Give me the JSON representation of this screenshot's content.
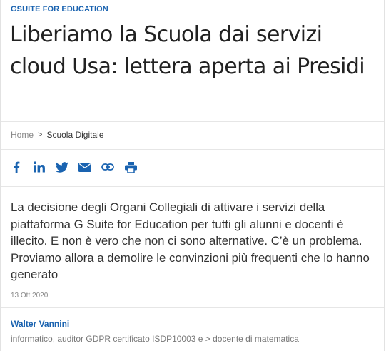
{
  "article": {
    "category": "GSUITE FOR EDUCATION",
    "title": "Liberiamo la Scuola dai servizi cloud Usa: lettera aperta ai Presidi",
    "lead": "La decisione degli Organi Collegiali di attivare i servizi della piattaforma G Suite for Education per tutti gli alunni e docenti è illecito. E non è vero che non ci sono alternative. C’è un problema. Proviamo allora a demolire le convinzioni più frequenti che lo hanno generato",
    "date": "13 Ott 2020"
  },
  "breadcrumb": {
    "home": "Home",
    "separator": ">",
    "current": "Scuola Digitale"
  },
  "share": {
    "icons": [
      "facebook-icon",
      "linkedin-icon",
      "twitter-icon",
      "email-icon",
      "link-icon",
      "print-icon"
    ],
    "color": "#1a63b0"
  },
  "author": {
    "name": "Walter Vannini",
    "bio": "informatico, auditor GDPR certificato ISDP10003 e > docente di matematica"
  },
  "colors": {
    "accent": "#1a63b0",
    "text": "#222222",
    "muted": "#888888"
  }
}
